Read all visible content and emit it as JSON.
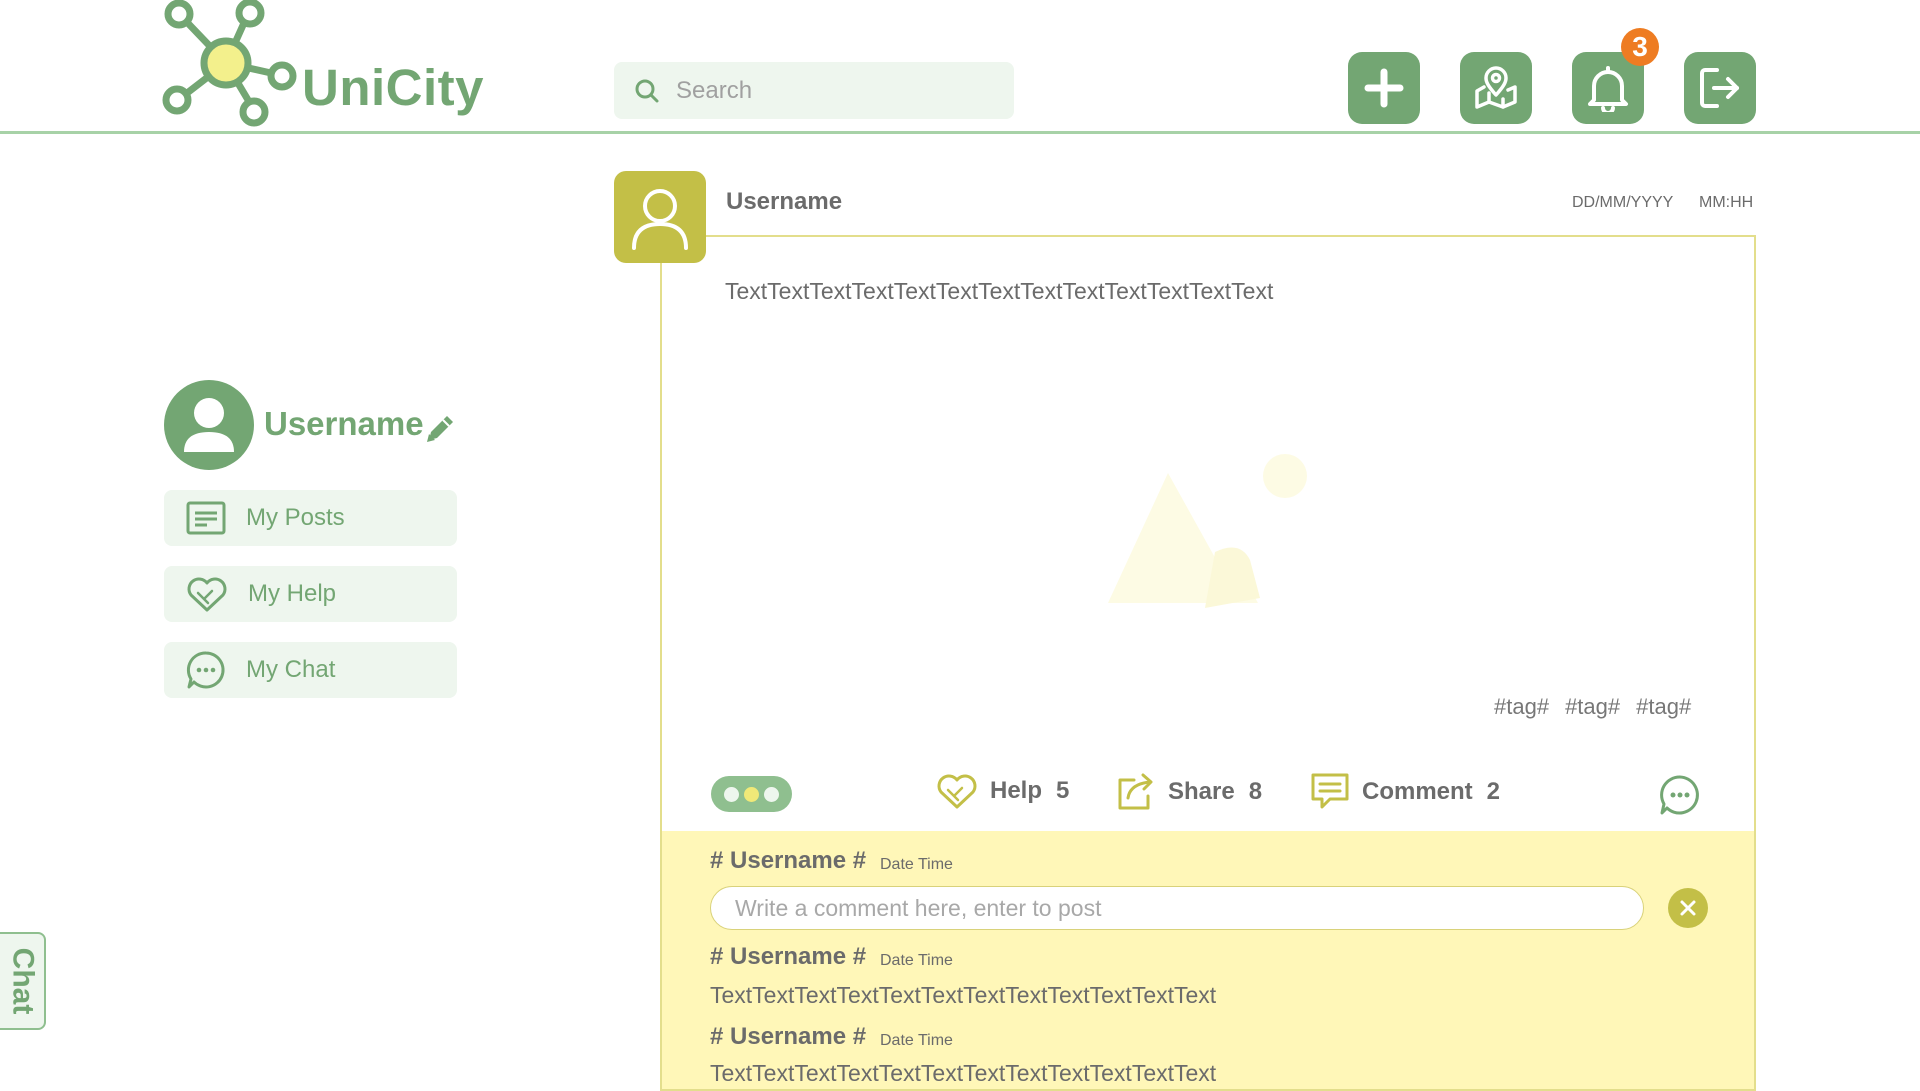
{
  "header": {
    "brand": "UniCity",
    "search_placeholder": "Search",
    "notification_count": "3",
    "icons": [
      "plus-icon",
      "map-pin-icon",
      "bell-icon",
      "logout-icon"
    ]
  },
  "sidebar": {
    "username": "Username",
    "items": [
      {
        "label": "My Posts",
        "icon": "posts-icon"
      },
      {
        "label": "My Help",
        "icon": "help-heart-icon"
      },
      {
        "label": "My Chat",
        "icon": "chat-icon"
      }
    ],
    "chat_tab": "Chat"
  },
  "post": {
    "username": "Username",
    "date": "DD/MM/YYYY",
    "time": "MM:HH",
    "text": "TextTextTextTextTextTextTextTextTextTextTextTextText",
    "tags": [
      "#tag#",
      "#tag#",
      "#tag#"
    ],
    "actions": {
      "help_label": "Help",
      "help_count": "5",
      "share_label": "Share",
      "share_count": "8",
      "comment_label": "Comment",
      "comment_count": "2"
    }
  },
  "comments": {
    "compose_user": "# Username #",
    "compose_date": "Date Time",
    "input_placeholder": "Write a comment here, enter to post",
    "items": [
      {
        "user": "# Username #",
        "date": "Date Time",
        "text": "TextTextTextTextTextTextTextTextTextTextTextText"
      },
      {
        "user": "# Username #",
        "date": "Date Time",
        "text": "TextTextTextTextTextTextTextTextTextTextTextText"
      }
    ]
  },
  "colors": {
    "green": "#73a673",
    "light_green": "#eef6ee",
    "olive": "#c3bf47",
    "comment_bg": "#fff7b8",
    "badge": "#ee7c22"
  }
}
